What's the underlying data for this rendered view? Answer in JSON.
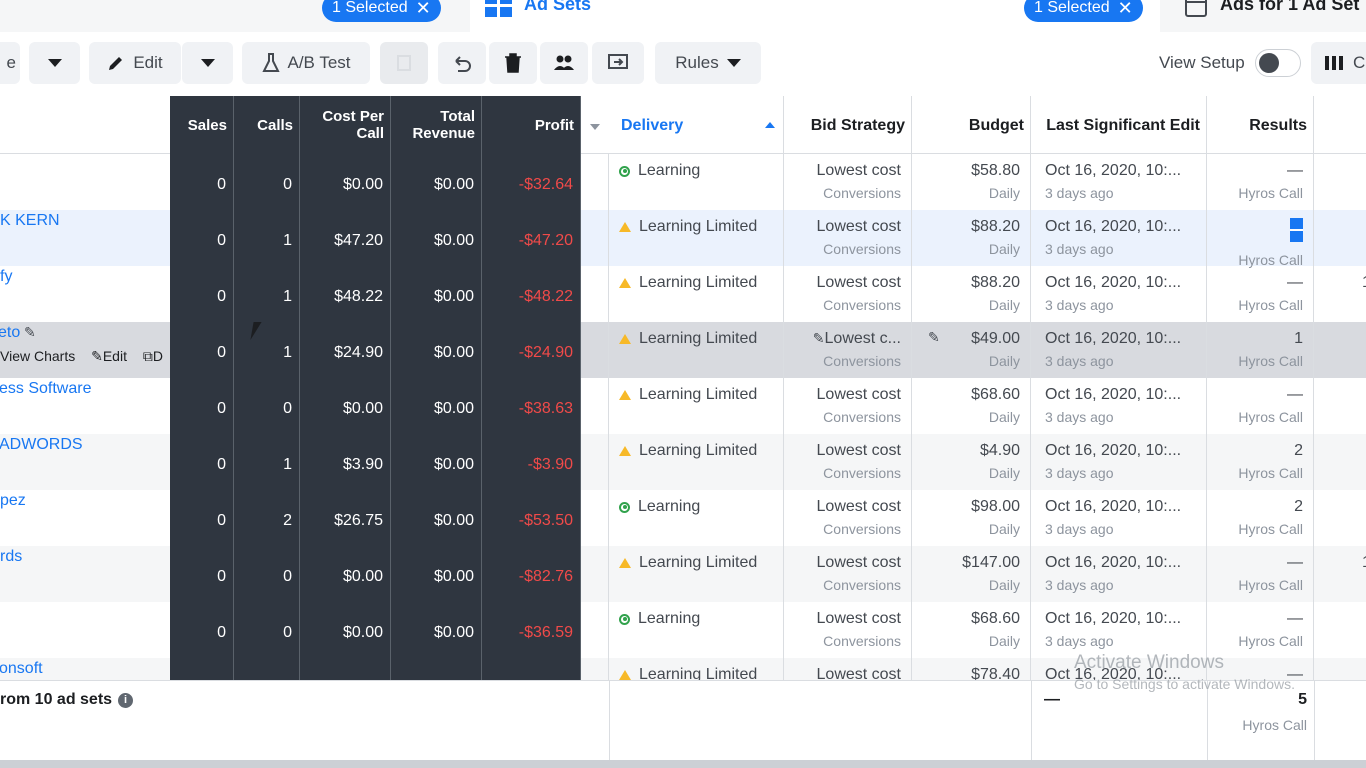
{
  "tabs": {
    "campaigns_selected": "1 Selected",
    "adsets_title": "Ad Sets",
    "adsets_selected": "1 Selected",
    "ads_title": "Ads for 1 Ad Set"
  },
  "toolbar": {
    "partial_label": "e",
    "edit_label": "Edit",
    "ab_test_label": "A/B Test",
    "rules_label": "Rules",
    "view_setup_label": "View Setup",
    "columns_partial": "C"
  },
  "headers": {
    "sales": "Sales",
    "calls": "Calls",
    "cost_per_call": "Cost Per Call",
    "total_revenue": "Total Revenue",
    "profit": "Profit",
    "delivery": "Delivery",
    "bid_strategy": "Bid Strategy",
    "budget": "Budget",
    "last_edit": "Last Significant Edit",
    "results": "Results"
  },
  "rows": [
    {
      "name": "",
      "sales": "0",
      "calls": "0",
      "cpc": "$0.00",
      "revenue": "$0.00",
      "profit": "-$32.64",
      "delivery": "Learning",
      "bid": "Lowest cost",
      "bid_sub": "Conversions",
      "budget": "$58.80",
      "budget_sub": "Daily",
      "edit": "Oct 16, 2020, 10:...",
      "edit_sub": "3 days ago",
      "result": "—",
      "result_sub": "Hyros Call",
      "extra": ""
    },
    {
      "name": "K KERN",
      "sales": "0",
      "calls": "1",
      "cpc": "$47.20",
      "revenue": "$0.00",
      "profit": "-$47.20",
      "delivery": "Learning Limited",
      "bid": "Lowest cost",
      "bid_sub": "Conversions",
      "budget": "$88.20",
      "budget_sub": "Daily",
      "edit": "Oct 16, 2020, 10:...",
      "edit_sub": "3 days ago",
      "result": "",
      "result_sub": "Hyros Call",
      "extra": ""
    },
    {
      "name": "fy",
      "sales": "0",
      "calls": "1",
      "cpc": "$48.22",
      "revenue": "$0.00",
      "profit": "-$48.22",
      "delivery": "Learning Limited",
      "bid": "Lowest cost",
      "bid_sub": "Conversions",
      "budget": "$88.20",
      "budget_sub": "Daily",
      "edit": "Oct 16, 2020, 10:...",
      "edit_sub": "3 days ago",
      "result": "—",
      "result_sub": "Hyros Call",
      "extra": "1"
    },
    {
      "name": "eto",
      "sales": "0",
      "calls": "1",
      "cpc": "$24.90",
      "revenue": "$0.00",
      "profit": "-$24.90",
      "delivery": "Learning Limited",
      "bid": "Lowest c...",
      "bid_sub": "Conversions",
      "budget": "$49.00",
      "budget_sub": "Daily",
      "edit": "Oct 16, 2020, 10:...",
      "edit_sub": "3 days ago",
      "result": "1",
      "result_sub": "Hyros Call",
      "extra": ""
    },
    {
      "name": "ess Software",
      "sales": "0",
      "calls": "0",
      "cpc": "$0.00",
      "revenue": "$0.00",
      "profit": "-$38.63",
      "delivery": "Learning Limited",
      "bid": "Lowest cost",
      "bid_sub": "Conversions",
      "budget": "$68.60",
      "budget_sub": "Daily",
      "edit": "Oct 16, 2020, 10:...",
      "edit_sub": "3 days ago",
      "result": "—",
      "result_sub": "Hyros Call",
      "extra": ""
    },
    {
      "name": "ADWORDS",
      "sales": "0",
      "calls": "1",
      "cpc": "$3.90",
      "revenue": "$0.00",
      "profit": "-$3.90",
      "delivery": "Learning Limited",
      "bid": "Lowest cost",
      "bid_sub": "Conversions",
      "budget": "$4.90",
      "budget_sub": "Daily",
      "edit": "Oct 16, 2020, 10:...",
      "edit_sub": "3 days ago",
      "result": "2",
      "result_sub": "Hyros Call",
      "extra": ""
    },
    {
      "name": "pez",
      "sales": "0",
      "calls": "2",
      "cpc": "$26.75",
      "revenue": "$0.00",
      "profit": "-$53.50",
      "delivery": "Learning",
      "bid": "Lowest cost",
      "bid_sub": "Conversions",
      "budget": "$98.00",
      "budget_sub": "Daily",
      "edit": "Oct 16, 2020, 10:...",
      "edit_sub": "3 days ago",
      "result": "2",
      "result_sub": "Hyros Call",
      "extra": ""
    },
    {
      "name": "rds",
      "sales": "0",
      "calls": "0",
      "cpc": "$0.00",
      "revenue": "$0.00",
      "profit": "-$82.76",
      "delivery": "Learning Limited",
      "bid": "Lowest cost",
      "bid_sub": "Conversions",
      "budget": "$147.00",
      "budget_sub": "Daily",
      "edit": "Oct 16, 2020, 10:...",
      "edit_sub": "3 days ago",
      "result": "—",
      "result_sub": "Hyros Call",
      "extra": "1"
    },
    {
      "name": "",
      "sales": "0",
      "calls": "0",
      "cpc": "$0.00",
      "revenue": "$0.00",
      "profit": "-$36.59",
      "delivery": "Learning",
      "bid": "Lowest cost",
      "bid_sub": "Conversions",
      "budget": "$68.60",
      "budget_sub": "Daily",
      "edit": "Oct 16, 2020, 10:...",
      "edit_sub": "3 days ago",
      "result": "—",
      "result_sub": "Hyros Call",
      "extra": ""
    },
    {
      "name": "onsoft",
      "sales": "",
      "calls": "",
      "cpc": "",
      "revenue": "",
      "profit": "",
      "delivery": "Learning Limited",
      "bid": "Lowest cost",
      "bid_sub": "",
      "budget": "$78.40",
      "budget_sub": "",
      "edit": "Oct 16, 2020, 10:...",
      "edit_sub": "",
      "result": "—",
      "result_sub": "",
      "extra": ""
    }
  ],
  "row_hover_actions": {
    "view_charts": "View Charts",
    "edit": "Edit",
    "duplicate_partial": "D"
  },
  "footer": {
    "label": "rom 10 ad sets",
    "edit_dash": "—",
    "results_total": "5",
    "results_sub": "Hyros Call"
  },
  "watermark": {
    "line1": "Activate Windows",
    "line2": "Go to Settings to activate Windows."
  },
  "colors": {
    "accent": "#1877f2",
    "dark_column": "#2f3640",
    "negative": "#f04a49",
    "learning": "#31a24c",
    "limited": "#f7b928"
  }
}
